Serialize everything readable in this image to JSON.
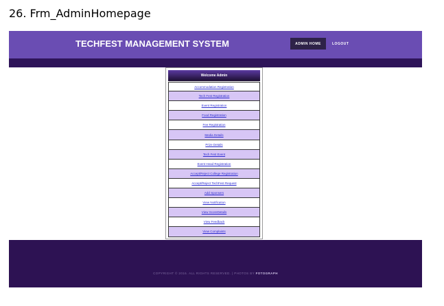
{
  "caption": "26. Frm_AdminHomepage",
  "header": {
    "title": "TECHFEST MANAGEMENT SYSTEM",
    "nav": {
      "admin_home": "ADMIN HOME",
      "logout": "LOGOUT"
    }
  },
  "menu": {
    "heading": "Welcome Admin",
    "items": [
      "Accommodation Registration",
      "Tech Fest Registration",
      "Event Registration",
      "Food Registration",
      "Fee Registration",
      "Media Details",
      "Prize Details",
      "Tech Fest Event",
      "Event Head Registration",
      "Accept/Reject College Registration",
      "Accept/Reject TechFest Request",
      "Add Sponsers",
      "View Notification",
      "View ScoreDetails",
      "View Feedback",
      "View Complaints"
    ]
  },
  "footer": {
    "copyright": "COPYRIGHT © 2016. ALL RIGHTS RESERVED. | PHOTOS BY",
    "photographer": "FOTOGRAPH"
  },
  "colors": {
    "header": "#6a4db3",
    "header_strip": "#2e1459",
    "menu_alt": "#d7c6f5",
    "footer": "#2d1253"
  }
}
